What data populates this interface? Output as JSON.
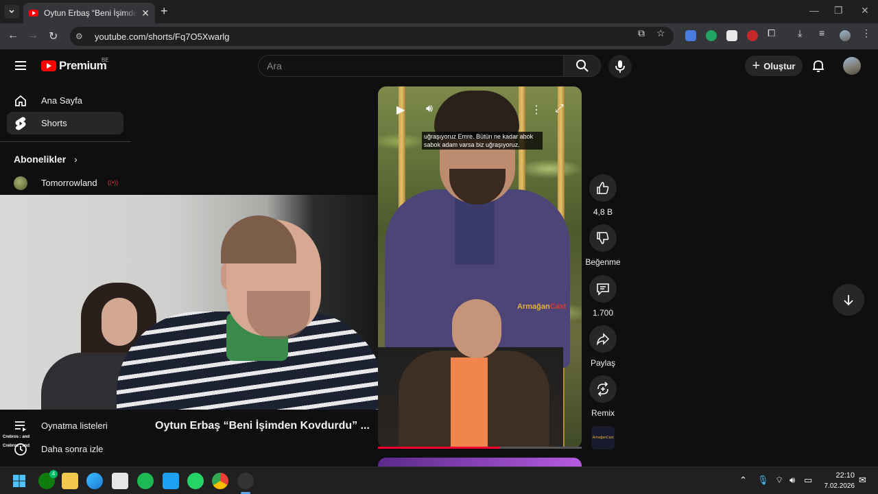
{
  "browser": {
    "tab_title": "Oytun Erbaş “Beni İşimden Kovdurdu” ...",
    "tab_close": "✕",
    "new_tab": "+",
    "url": "youtube.com/shorts/Fq7O5Xwarlg"
  },
  "youtube": {
    "logo_text": "Premium",
    "country_code": "BE",
    "search_placeholder": "Ara",
    "create_label": "Oluştur"
  },
  "sidebar": {
    "items": [
      {
        "label": "Ana Sayfa",
        "icon": "home-icon"
      },
      {
        "label": "Shorts",
        "icon": "shorts-icon"
      }
    ],
    "subscriptions_heading": "Abonelikler",
    "subscriptions": [
      {
        "label": "Tomorrowland",
        "live": true
      }
    ],
    "bottom_items": [
      {
        "label": "Oynatma listeleri",
        "icon": "playlist-icon"
      },
      {
        "label": "Daha sonra izle",
        "icon": "clock-icon"
      }
    ]
  },
  "overlay": {
    "chat_line_1": "Crebros : and",
    "chat_line_2": "Crebros : and"
  },
  "short": {
    "title": "Oytun Erbaş “Beni İşimden Kovdurdu” ...",
    "caption": "uğraşıyoruz Emre. Bütün ne kadar abok sabok adam varsa biz uğraşıyoruz.",
    "brand_a": "Armağan",
    "brand_b": "Cast",
    "channel_thumb_text": "ArmağanCast",
    "progress": 0.6
  },
  "actions": {
    "like_count": "4,8 B",
    "dislike_label": "Beğenme",
    "comment_count": "1.700",
    "share_label": "Paylaş",
    "remix_label": "Remix"
  },
  "taskbar": {
    "time": "22:10",
    "date": "7.02.2026",
    "xbox_badge": "4"
  },
  "colors": {
    "accent": "#ff0000",
    "progress": "#ff0033",
    "background": "#0f0f0f"
  }
}
